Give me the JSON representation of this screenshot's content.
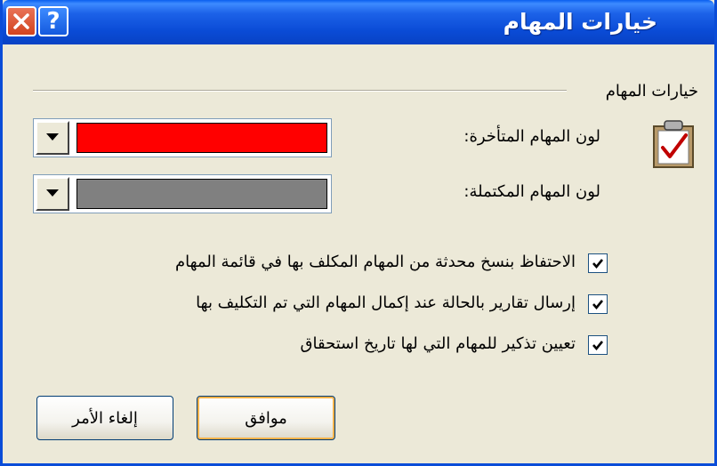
{
  "window": {
    "title": "خيارات المهام"
  },
  "titlebar": {
    "help_label": "?",
    "close_label": "✕"
  },
  "group": {
    "title": "خيارات المهام"
  },
  "overdue": {
    "label": "لون المهام المتأخرة:",
    "color": "#FF0000"
  },
  "completed": {
    "label": "لون المهام المكتملة:",
    "color": "#808080"
  },
  "options": [
    {
      "label": "الاحتفاظ بنسخ محدثة من المهام المكلف بها في قائمة المهام",
      "checked": true
    },
    {
      "label": "إرسال تقارير بالحالة عند إكمال المهام التي تم التكليف بها",
      "checked": true
    },
    {
      "label": "تعيين تذكير للمهام التي لها تاريخ استحقاق",
      "checked": true
    }
  ],
  "buttons": {
    "ok": "موافق",
    "cancel": "إلغاء الأمر"
  },
  "icons": {
    "clipboard": "clipboard-check-icon",
    "dropdown": "chevron-down-icon",
    "checkmark": "checkmark-icon"
  }
}
